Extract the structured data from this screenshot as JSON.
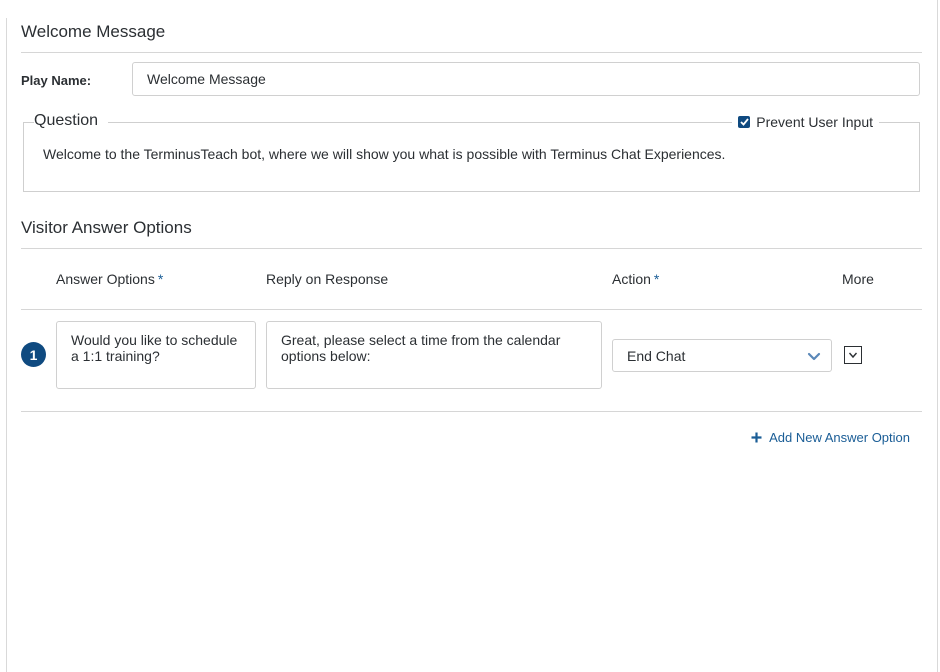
{
  "header": {
    "title": "Welcome Message"
  },
  "play_name": {
    "label": "Play Name:",
    "value": "Welcome Message"
  },
  "question": {
    "legend": "Question",
    "prevent_user_input": {
      "label": "Prevent User Input",
      "checked": true
    },
    "text": "Welcome to the TerminusTeach bot, where we will show you what is possible with Terminus Chat Experiences."
  },
  "answers": {
    "title": "Visitor Answer Options",
    "columns": {
      "answer_options": "Answer Options",
      "reply_on_response": "Reply on Response",
      "action": "Action",
      "more": "More",
      "required_marker": "*"
    },
    "rows": [
      {
        "number": "1",
        "answer": "Would you like to schedule a 1:1 training?",
        "reply": "Great, please select a time from the calendar options below:",
        "action": "End Chat"
      }
    ],
    "add_label": "Add New Answer Option"
  },
  "colors": {
    "accent": "#0f4a80",
    "link": "#1a5d96",
    "border": "#d0d0d0"
  },
  "icons": {
    "checkbox": "check-icon",
    "select": "chevron-down-icon",
    "more": "chevron-down-box-icon",
    "add": "plus-icon"
  }
}
